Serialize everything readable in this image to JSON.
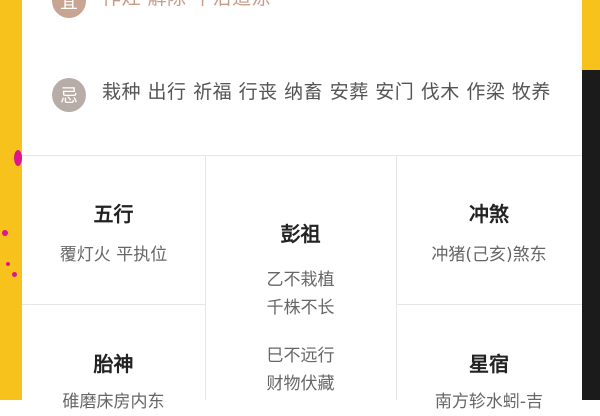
{
  "yi": {
    "badge": "宜",
    "items": "作灶 解除 平治道涂"
  },
  "ji": {
    "badge": "忌",
    "items": "栽种 出行 祈福 行丧 纳畜 安葬 安门 伐木 作梁 牧养"
  },
  "wuxing": {
    "title": "五行",
    "value": "覆灯火 平执位"
  },
  "pengzu": {
    "title": "彭祖",
    "line1": "乙不栽植",
    "line2": "千株不长",
    "line3": "巳不远行",
    "line4": "财物伏藏"
  },
  "chongsha": {
    "title": "冲煞",
    "value": "冲猪(己亥)煞东"
  },
  "taishen": {
    "title": "胎神",
    "value": "碓磨床房内东"
  },
  "xingxiu": {
    "title": "星宿",
    "value": "南方轸水蚓-吉"
  },
  "colors": {
    "accent_left": "#f7c21b",
    "accent_dots": "#e0148e",
    "badge_bg": "#b8aca8"
  }
}
